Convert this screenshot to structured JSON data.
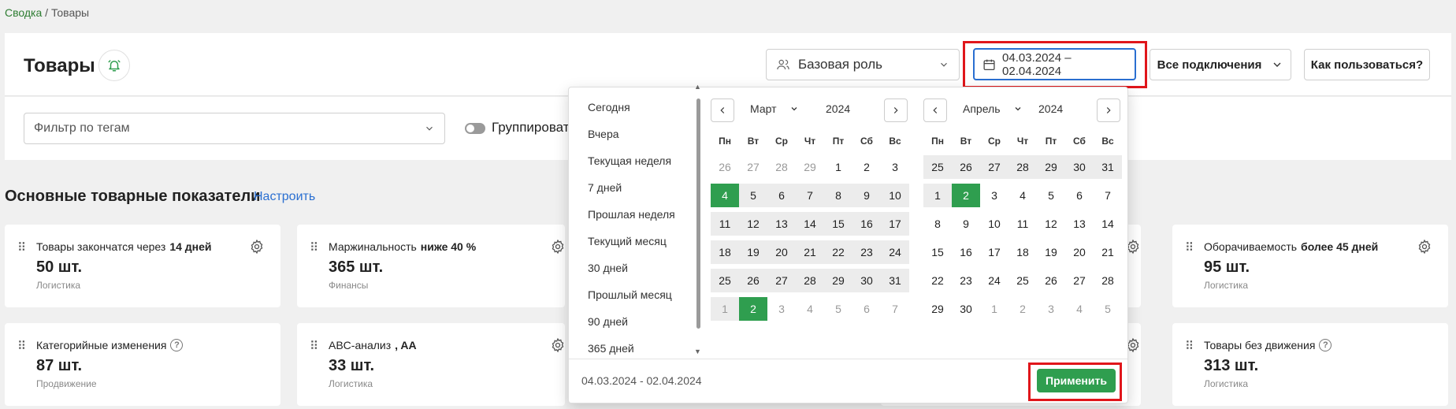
{
  "breadcrumb": {
    "root": "Сводка",
    "sep": "/",
    "current": "Товары"
  },
  "header": {
    "title": "Товары",
    "role_select": "Базовая роль",
    "date_range": "04.03.2024 – 02.04.2024",
    "connections": "Все подключения",
    "help": "Как пользоваться?"
  },
  "filters": {
    "tags_placeholder": "Фильтр по тегам",
    "group_label": "Группироват"
  },
  "section": {
    "title": "Основные товарные показатели",
    "configure": "Настроить"
  },
  "metrics": [
    {
      "title": "Товары закончатся через",
      "qualifier": "14 дней",
      "value": "50 шт.",
      "category": "Логистика"
    },
    {
      "title": "Маржинальность",
      "qualifier": "ниже 40 %",
      "value": "365 шт.",
      "category": "Финансы"
    },
    {
      "title": "Оборачиваемость",
      "qualifier": "более 45 дней",
      "value": "95 шт.",
      "category": "Логистика"
    },
    {
      "title": "Категорийные изменения",
      "qualifier": "",
      "value": "87 шт.",
      "category": "Продвижение"
    },
    {
      "title": "ABC-анализ",
      "qualifier": ", AA",
      "value": "33 шт.",
      "category": "Логистика"
    },
    {
      "title": "Товары без движения",
      "qualifier": "",
      "value": "313 шт.",
      "category": "Логистика"
    }
  ],
  "datepicker": {
    "presets": [
      "Сегодня",
      "Вчера",
      "Текущая неделя",
      "7 дней",
      "Прошлая неделя",
      "Текущий месяц",
      "30 дней",
      "Прошлый месяц",
      "90 дней",
      "365 дней"
    ],
    "weekdays": [
      "Пн",
      "Вт",
      "Ср",
      "Чт",
      "Пт",
      "Сб",
      "Вс"
    ],
    "left": {
      "month": "Март",
      "year": "2024",
      "days": [
        {
          "d": "26",
          "o": true,
          "r": false
        },
        {
          "d": "27",
          "o": true,
          "r": false
        },
        {
          "d": "28",
          "o": true,
          "r": false
        },
        {
          "d": "29",
          "o": true,
          "r": false
        },
        {
          "d": "1",
          "o": false,
          "r": false
        },
        {
          "d": "2",
          "o": false,
          "r": false
        },
        {
          "d": "3",
          "o": false,
          "r": false
        },
        {
          "d": "4",
          "o": false,
          "r": true,
          "s": true
        },
        {
          "d": "5",
          "o": false,
          "r": true
        },
        {
          "d": "6",
          "o": false,
          "r": true
        },
        {
          "d": "7",
          "o": false,
          "r": true
        },
        {
          "d": "8",
          "o": false,
          "r": true
        },
        {
          "d": "9",
          "o": false,
          "r": true
        },
        {
          "d": "10",
          "o": false,
          "r": true
        },
        {
          "d": "11",
          "o": false,
          "r": true
        },
        {
          "d": "12",
          "o": false,
          "r": true
        },
        {
          "d": "13",
          "o": false,
          "r": true
        },
        {
          "d": "14",
          "o": false,
          "r": true
        },
        {
          "d": "15",
          "o": false,
          "r": true
        },
        {
          "d": "16",
          "o": false,
          "r": true
        },
        {
          "d": "17",
          "o": false,
          "r": true
        },
        {
          "d": "18",
          "o": false,
          "r": true
        },
        {
          "d": "19",
          "o": false,
          "r": true
        },
        {
          "d": "20",
          "o": false,
          "r": true
        },
        {
          "d": "21",
          "o": false,
          "r": true
        },
        {
          "d": "22",
          "o": false,
          "r": true
        },
        {
          "d": "23",
          "o": false,
          "r": true
        },
        {
          "d": "24",
          "o": false,
          "r": true
        },
        {
          "d": "25",
          "o": false,
          "r": true
        },
        {
          "d": "26",
          "o": false,
          "r": true
        },
        {
          "d": "27",
          "o": false,
          "r": true
        },
        {
          "d": "28",
          "o": false,
          "r": true
        },
        {
          "d": "29",
          "o": false,
          "r": true
        },
        {
          "d": "30",
          "o": false,
          "r": true
        },
        {
          "d": "31",
          "o": false,
          "r": true
        },
        {
          "d": "1",
          "o": true,
          "r": true
        },
        {
          "d": "2",
          "o": true,
          "r": false,
          "s": true
        },
        {
          "d": "3",
          "o": true,
          "r": false
        },
        {
          "d": "4",
          "o": true,
          "r": false
        },
        {
          "d": "5",
          "o": true,
          "r": false
        },
        {
          "d": "6",
          "o": true,
          "r": false
        },
        {
          "d": "7",
          "o": true,
          "r": false
        }
      ]
    },
    "right": {
      "month": "Апрель",
      "year": "2024",
      "days": [
        {
          "d": "25",
          "o": false,
          "r": true
        },
        {
          "d": "26",
          "o": false,
          "r": true
        },
        {
          "d": "27",
          "o": false,
          "r": true
        },
        {
          "d": "28",
          "o": false,
          "r": true
        },
        {
          "d": "29",
          "o": false,
          "r": true
        },
        {
          "d": "30",
          "o": false,
          "r": true
        },
        {
          "d": "31",
          "o": false,
          "r": true
        },
        {
          "d": "1",
          "o": false,
          "r": true
        },
        {
          "d": "2",
          "o": false,
          "r": false,
          "s": true
        },
        {
          "d": "3",
          "o": false,
          "r": false
        },
        {
          "d": "4",
          "o": false,
          "r": false
        },
        {
          "d": "5",
          "o": false,
          "r": false
        },
        {
          "d": "6",
          "o": false,
          "r": false
        },
        {
          "d": "7",
          "o": false,
          "r": false
        },
        {
          "d": "8",
          "o": false,
          "r": false
        },
        {
          "d": "9",
          "o": false,
          "r": false
        },
        {
          "d": "10",
          "o": false,
          "r": false
        },
        {
          "d": "11",
          "o": false,
          "r": false
        },
        {
          "d": "12",
          "o": false,
          "r": false
        },
        {
          "d": "13",
          "o": false,
          "r": false
        },
        {
          "d": "14",
          "o": false,
          "r": false
        },
        {
          "d": "15",
          "o": false,
          "r": false
        },
        {
          "d": "16",
          "o": false,
          "r": false
        },
        {
          "d": "17",
          "o": false,
          "r": false
        },
        {
          "d": "18",
          "o": false,
          "r": false
        },
        {
          "d": "19",
          "o": false,
          "r": false
        },
        {
          "d": "20",
          "o": false,
          "r": false
        },
        {
          "d": "21",
          "o": false,
          "r": false
        },
        {
          "d": "22",
          "o": false,
          "r": false
        },
        {
          "d": "23",
          "o": false,
          "r": false
        },
        {
          "d": "24",
          "o": false,
          "r": false
        },
        {
          "d": "25",
          "o": false,
          "r": false
        },
        {
          "d": "26",
          "o": false,
          "r": false
        },
        {
          "d": "27",
          "o": false,
          "r": false
        },
        {
          "d": "28",
          "o": false,
          "r": false
        },
        {
          "d": "29",
          "o": false,
          "r": false
        },
        {
          "d": "30",
          "o": false,
          "r": false
        },
        {
          "d": "1",
          "o": true,
          "r": false
        },
        {
          "d": "2",
          "o": true,
          "r": false
        },
        {
          "d": "3",
          "o": true,
          "r": false
        },
        {
          "d": "4",
          "o": true,
          "r": false
        },
        {
          "d": "5",
          "o": true,
          "r": false
        }
      ]
    },
    "footer_range": "04.03.2024 - 02.04.2024",
    "apply": "Применить"
  },
  "colors": {
    "accent_green": "#2f9e4f",
    "link_blue": "#2a6fd1",
    "highlight_red": "#e0161b"
  }
}
